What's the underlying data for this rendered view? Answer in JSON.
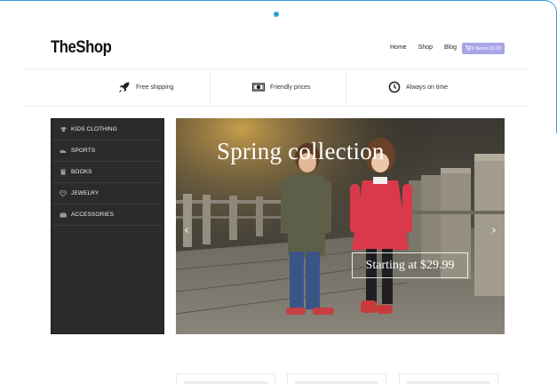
{
  "header": {
    "logo": "TheShop",
    "nav": [
      "Home",
      "Shop",
      "Blog"
    ],
    "cart_label": "0 items £0.00"
  },
  "features": [
    {
      "label": "Free shipping",
      "icon": "rocket-icon"
    },
    {
      "label": "Friendly prices",
      "icon": "banknote-icon"
    },
    {
      "label": "Always on time",
      "icon": "clock-icon"
    }
  ],
  "sidebar": {
    "items": [
      {
        "label": "KIDS CLOTHING",
        "icon": "shirt-icon"
      },
      {
        "label": "SPORTS",
        "icon": "shoe-icon"
      },
      {
        "label": "BOOKS",
        "icon": "book-icon"
      },
      {
        "label": "JEWELRY",
        "icon": "diamond-icon"
      },
      {
        "label": "ACCESSORIES",
        "icon": "bag-icon"
      }
    ]
  },
  "hero": {
    "title": "Spring collection",
    "price_label": "Starting at $29.99",
    "prev_arrow": "‹",
    "next_arrow": "›"
  },
  "colors": {
    "accent": "#2ea0d8",
    "cart_button": "#a9a6e8",
    "sidebar_bg": "#2b2b2b",
    "coat_red": "#d9394a"
  }
}
